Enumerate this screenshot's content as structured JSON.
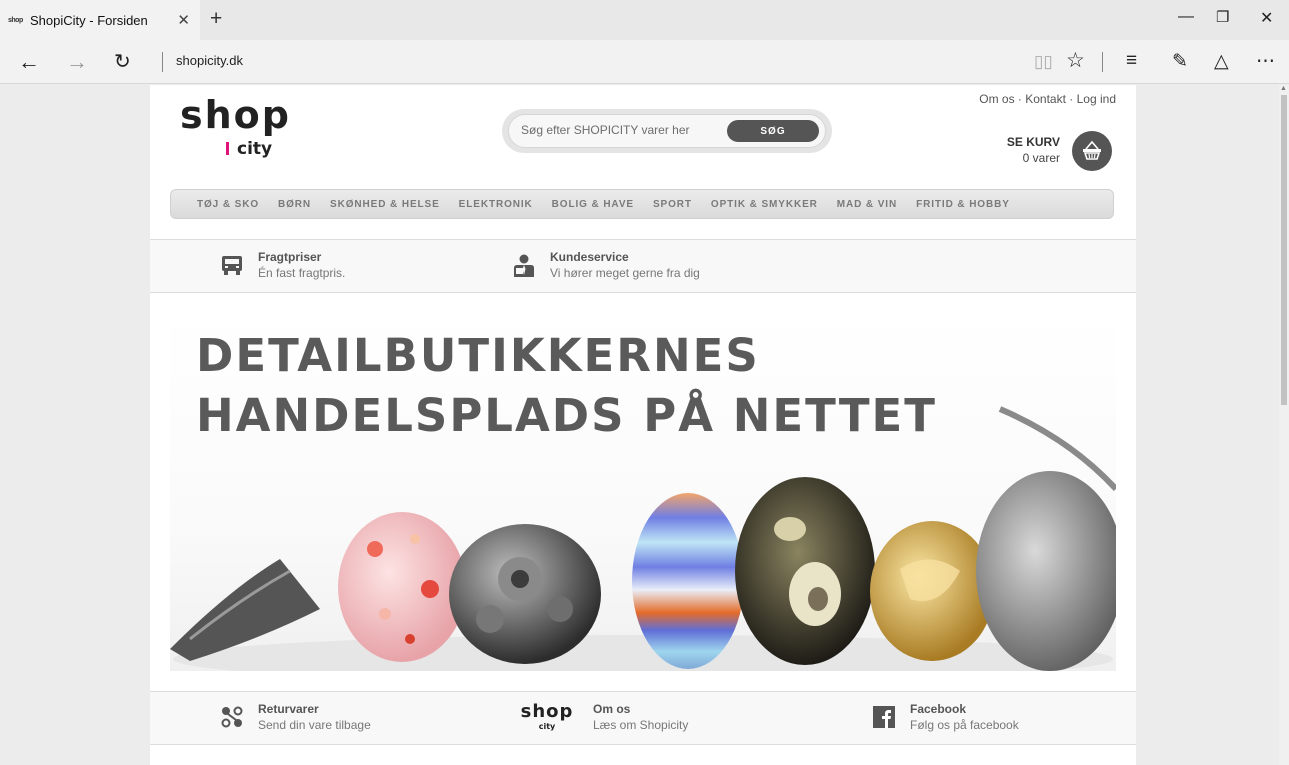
{
  "browser": {
    "tab_title": "ShopiCity - Forsiden",
    "favicon_text": "shop",
    "url": "shopicity.dk"
  },
  "header": {
    "logo_shop": "shop",
    "logo_city": "city",
    "search_placeholder": "Søg efter SHOPICITY varer her",
    "search_button": "SØG",
    "top_links": [
      "Om os",
      "Kontakt",
      "Log ind"
    ],
    "top_link_separator": " · ",
    "basket_title": "SE KURV",
    "basket_count": "0 varer"
  },
  "menu": {
    "items": [
      "TØJ & SKO",
      "BØRN",
      "SKØNHED & HELSE",
      "ELEKTRONIK",
      "BOLIG & HAVE",
      "SPORT",
      "OPTIK & SMYKKER",
      "MAD & VIN",
      "FRITID & HOBBY"
    ]
  },
  "info_top": [
    {
      "title": "Fragtpriser",
      "sub": "Én fast fragtpris.",
      "icon": "truck-icon"
    },
    {
      "title": "Kundeservice",
      "sub": "Vi hører meget gerne fra dig",
      "icon": "customer-service-icon"
    }
  ],
  "hero": {
    "line1": "DETAILBUTIKKERNES",
    "line2": "HANDELSPLADS PÅ NETTET"
  },
  "info_bottom": [
    {
      "title": "Returvarer",
      "sub": "Send din vare tilbage",
      "icon": "returns-icon"
    },
    {
      "title": "Om os",
      "sub": "Læs om Shopicity",
      "icon": "shopicity-logo"
    },
    {
      "title": "Facebook",
      "sub": "Følg os på facebook",
      "icon": "facebook-icon"
    }
  ],
  "colors": {
    "brand_accent": "#e0137a",
    "button_dark": "#555555",
    "menu_text": "#7a7a7a",
    "hero_text": "#5a5a5a"
  }
}
